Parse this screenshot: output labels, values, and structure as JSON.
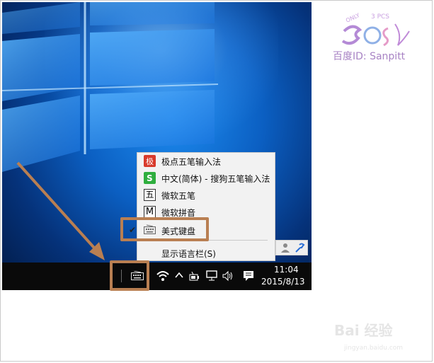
{
  "ime_menu": {
    "items": [
      {
        "label": "极点五笔输入法",
        "icon": "jidian-ime-icon",
        "checked": false
      },
      {
        "label": "中文(简体) - 搜狗五笔输入法",
        "icon": "sogou-ime-icon",
        "checked": false
      },
      {
        "label": "微软五笔",
        "icon": "wubi-char-icon",
        "icon_text": "五",
        "checked": false
      },
      {
        "label": "微软拼音",
        "icon": "m-letter-icon",
        "icon_text": "M",
        "checked": false
      },
      {
        "label": "美式键盘",
        "icon": "keyboard-icon",
        "checked": true
      }
    ],
    "check_mark": "✔",
    "show_language_bar_label": "显示语言栏(S)"
  },
  "taskbar": {
    "time": "11:04",
    "date": "2015/8/13",
    "tray_icons": [
      "keyboard-icon",
      "wifi-icon",
      "chevron-up-icon",
      "battery-icon",
      "network-icon",
      "volume-icon",
      "notification-icon"
    ]
  },
  "watermark": {
    "text": "百度ID: Sanpitt",
    "logo_text_small": "ONLY",
    "logo_text_top": "3 PCS",
    "site_text": "jingyan.baidu.com",
    "baidu_text": "Bai 经验"
  },
  "colors": {
    "callout": "#b97f52",
    "desktop_blue": "#0b5fc2",
    "menu_bg": "#f2f2f2",
    "taskbar_bg": "#0a0a0a",
    "watermark_purple": "#a883c4"
  }
}
